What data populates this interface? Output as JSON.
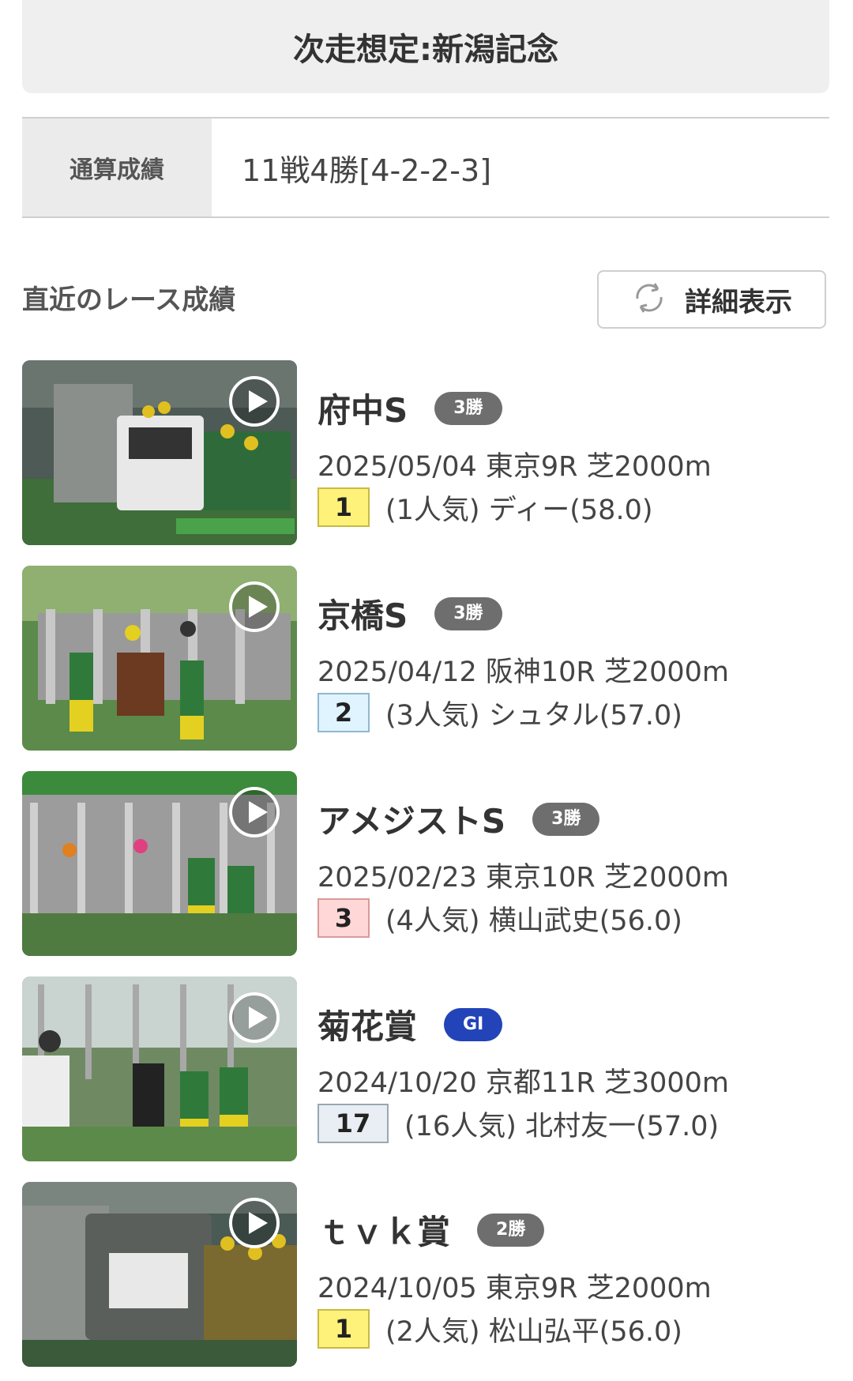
{
  "header": {
    "next_race": "次走想定:新潟記念"
  },
  "record": {
    "label": "通算成績",
    "value": "11戦4勝[4-2-2-3]"
  },
  "recent": {
    "title": "直近のレース成績",
    "detail_button": "詳細表示"
  },
  "races": [
    {
      "name": "府中S",
      "grade": "3勝",
      "meta": "2025/05/04 東京9R 芝2000m",
      "position": "1",
      "result": "(1人気) ディー(58.0)"
    },
    {
      "name": "京橋S",
      "grade": "3勝",
      "meta": "2025/04/12 阪神10R 芝2000m",
      "position": "2",
      "result": "(3人気) シュタル(57.0)"
    },
    {
      "name": "アメジストS",
      "grade": "3勝",
      "meta": "2025/02/23 東京10R 芝2000m",
      "position": "3",
      "result": "(4人気) 横山武史(56.0)"
    },
    {
      "name": "菊花賞",
      "grade": "GI",
      "meta": "2024/10/20 京都11R 芝3000m",
      "position": "17",
      "result": "(16人気) 北村友一(57.0)"
    },
    {
      "name": "ｔｖｋ賞",
      "grade": "2勝",
      "meta": "2024/10/05 東京9R 芝2000m",
      "position": "1",
      "result": "(2人気) 松山弘平(56.0)"
    }
  ],
  "colors": {
    "first": "#fff27a",
    "second": "#dff4ff",
    "third": "#ffd7d7",
    "other": "#e8eef3",
    "grade_default": "#6e6e6e",
    "grade_g1": "#2244b8"
  },
  "icons": {
    "detail": "refresh-icon",
    "video": "play-icon"
  }
}
